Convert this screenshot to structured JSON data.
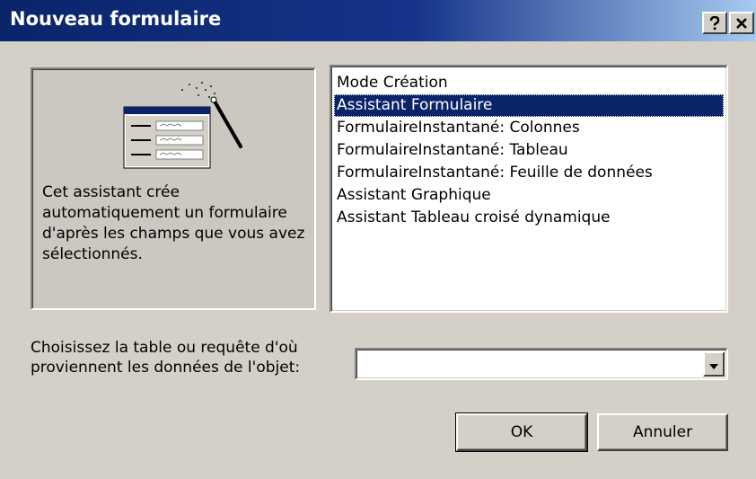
{
  "window": {
    "title": "Nouveau formulaire",
    "help_button_label": "?",
    "close_button_label": "×"
  },
  "description": {
    "icon": "form-wizard-icon",
    "text": "Cet assistant crée automatiquement un formulaire d'après les champs que vous avez sélectionnés."
  },
  "form_types": {
    "selected_index": 1,
    "items": [
      {
        "label": "Mode Création"
      },
      {
        "label": "Assistant Formulaire"
      },
      {
        "label": "FormulaireInstantané:  Colonnes"
      },
      {
        "label": "FormulaireInstantané:  Tableau"
      },
      {
        "label": "FormulaireInstantané:  Feuille de données"
      },
      {
        "label": "Assistant Graphique"
      },
      {
        "label": "Assistant Tableau croisé dynamique"
      }
    ]
  },
  "source": {
    "label": "Choisissez la table ou requête d'où proviennent les données de l'objet:",
    "value": "",
    "dropdown_icon": "chevron-down-icon"
  },
  "buttons": {
    "ok_label": "OK",
    "cancel_label": "Annuler"
  },
  "colors": {
    "title_bar": "#0a246a",
    "title_bar_end": "#a6caf0",
    "selection": "#0a246a",
    "dialog_face": "#d4d0c8",
    "panel_face": "#cbc8c1"
  }
}
